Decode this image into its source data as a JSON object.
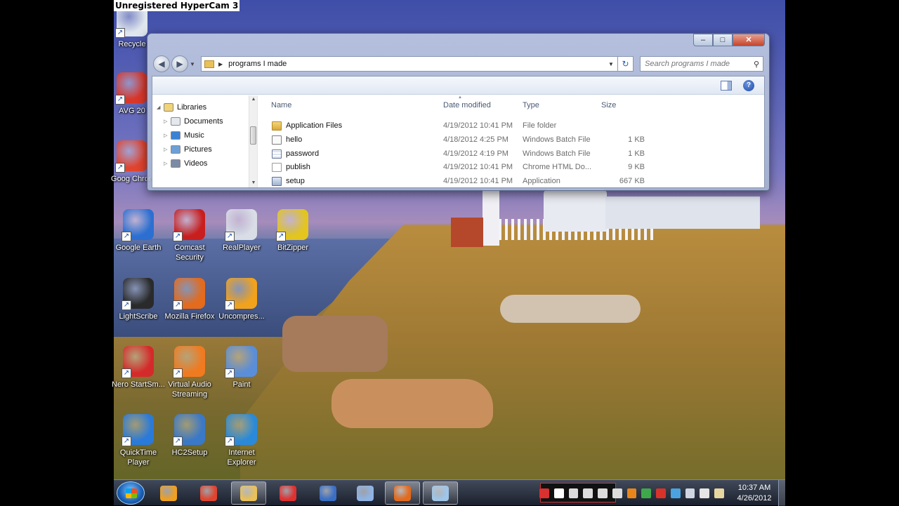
{
  "watermark": "Unregistered HyperCam 3",
  "desktop_icons": [
    {
      "label": "Recycle",
      "icon": "recycle-bin-icon",
      "color": "#dfe6ee"
    },
    {
      "label": "AVG 20",
      "icon": "avg-icon",
      "color": "#d9372a"
    },
    {
      "label": "Goog Chron",
      "icon": "google-chrome-icon",
      "color": "#e0442f"
    },
    {
      "label": "Google Earth",
      "icon": "google-earth-icon",
      "color": "#2c6fd1"
    },
    {
      "label": "Comcast Security",
      "icon": "comcast-security-icon",
      "color": "#c81e1e"
    },
    {
      "label": "RealPlayer",
      "icon": "realplayer-icon",
      "color": "#d9dde6"
    },
    {
      "label": "BitZipper",
      "icon": "bitzipper-icon",
      "color": "#e3c51e"
    },
    {
      "label": "LightScribe",
      "icon": "lightscribe-icon",
      "color": "#2a2a2a"
    },
    {
      "label": "Mozilla Firefox",
      "icon": "firefox-icon",
      "color": "#e46a1c"
    },
    {
      "label": "Uncompres...",
      "icon": "uncompress-icon",
      "color": "#f1a21c"
    },
    {
      "label": "Nero StartSm...",
      "icon": "nero-icon",
      "color": "#d42a2a"
    },
    {
      "label": "Virtual Audio Streaming",
      "icon": "speaker-icon",
      "color": "#f07a20"
    },
    {
      "label": "Paint",
      "icon": "paint-icon",
      "color": "#5a8ed8"
    },
    {
      "label": "QuickTime Player",
      "icon": "quicktime-icon",
      "color": "#2a7ad9"
    },
    {
      "label": "HC2Setup",
      "icon": "hc2setup-icon",
      "color": "#3a78c8"
    },
    {
      "label": "Internet Explorer",
      "icon": "internet-explorer-icon",
      "color": "#2a8ad9"
    }
  ],
  "explorer": {
    "address_crumb": "programs I made",
    "search_placeholder": "Search programs I made",
    "window_buttons": {
      "minimize": "–",
      "maximize": "□",
      "close": "✕"
    },
    "help": "?",
    "nav_tree": [
      {
        "label": "Libraries",
        "icon": "libraries-icon",
        "color": "#f1d379",
        "level": 0,
        "expander": "◢"
      },
      {
        "label": "Documents",
        "icon": "documents-icon",
        "color": "#e4e8ef",
        "level": 1,
        "expander": "▷"
      },
      {
        "label": "Music",
        "icon": "music-icon",
        "color": "#3b82d6",
        "level": 1,
        "expander": "▷"
      },
      {
        "label": "Pictures",
        "icon": "pictures-icon",
        "color": "#6da0d6",
        "level": 1,
        "expander": "▷"
      },
      {
        "label": "Videos",
        "icon": "videos-icon",
        "color": "#7c8aa6",
        "level": 1,
        "expander": "▷"
      }
    ],
    "columns": {
      "name": "Name",
      "date": "Date modified",
      "type": "Type",
      "size": "Size"
    },
    "files": [
      {
        "name": "Application Files",
        "date": "4/19/2012 10:41 PM",
        "type": "File folder",
        "size": "",
        "icon": "folder-icon",
        "icon_class": "ico-folder"
      },
      {
        "name": "hello",
        "date": "4/18/2012 4:25 PM",
        "type": "Windows Batch File",
        "size": "1 KB",
        "icon": "batch-file-icon",
        "icon_class": "ico-bat"
      },
      {
        "name": "password",
        "date": "4/19/2012 4:19 PM",
        "type": "Windows Batch File",
        "size": "1 KB",
        "icon": "batch-file-gear-icon",
        "icon_class": "ico-bat2"
      },
      {
        "name": "publish",
        "date": "4/19/2012 10:41 PM",
        "type": "Chrome HTML Do...",
        "size": "9 KB",
        "icon": "html-file-icon",
        "icon_class": "ico-html"
      },
      {
        "name": "setup",
        "date": "4/19/2012 10:41 PM",
        "type": "Application",
        "size": "667 KB",
        "icon": "application-icon",
        "icon_class": "ico-app"
      }
    ]
  },
  "taskbar": {
    "items": [
      {
        "name": "media-center-icon",
        "color": "#f0a020",
        "active": false
      },
      {
        "name": "chrome-taskbar-icon",
        "color": "#e0442f",
        "active": false
      },
      {
        "name": "explorer-taskbar-icon",
        "color": "#e9c15a",
        "active": true
      },
      {
        "name": "record-taskbar-icon",
        "color": "#e03030",
        "active": false
      },
      {
        "name": "vb-taskbar-icon",
        "color": "#3a6fc6",
        "active": false
      },
      {
        "name": "window-taskbar-icon",
        "color": "#8fb3e4",
        "active": false
      },
      {
        "name": "firefox-taskbar-icon",
        "color": "#e46a1c",
        "active": true
      },
      {
        "name": "unknown-taskbar-icon",
        "color": "#9fc6e8",
        "active": true
      }
    ],
    "tray_icons": [
      {
        "name": "hypercam-stop-icon",
        "color": "#d93030"
      },
      {
        "name": "hypercam-pause-icon",
        "color": "#ffffff"
      },
      {
        "name": "camera-tray-icon",
        "color": "#dcdcdc"
      },
      {
        "name": "mic-tray-icon",
        "color": "#dcdcdc"
      },
      {
        "name": "pen-tray-icon",
        "color": "#dcdcdc"
      },
      {
        "name": "settings-tray-icon",
        "color": "#dcdcdc"
      },
      {
        "name": "orange-tray-icon",
        "color": "#e8861c"
      },
      {
        "name": "green-tray-icon",
        "color": "#3fa84a"
      },
      {
        "name": "red-tray-icon",
        "color": "#d8332a"
      },
      {
        "name": "network-tray-icon",
        "color": "#4aa3e0"
      },
      {
        "name": "monitor-tray-icon",
        "color": "#cfd6e2"
      },
      {
        "name": "volume-tray-icon",
        "color": "#e5e5e5"
      },
      {
        "name": "flag-tray-icon",
        "color": "#e8d6a0"
      }
    ],
    "time": "10:37 AM",
    "date": "4/26/2012"
  }
}
